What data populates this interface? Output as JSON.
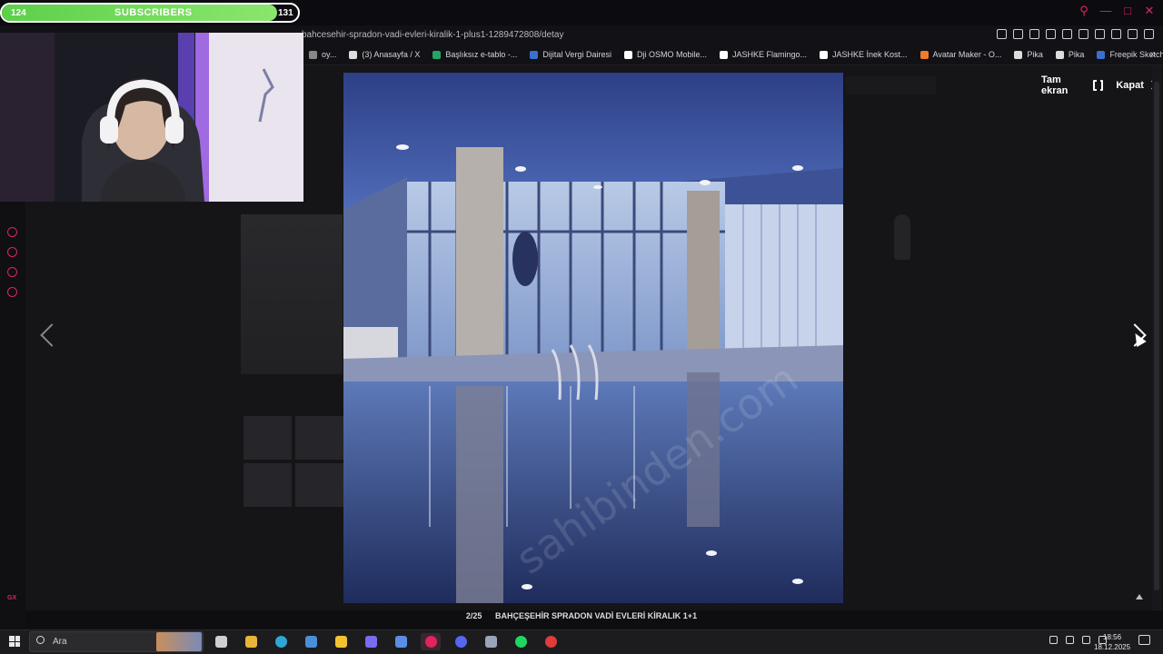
{
  "browser": {
    "url": "bahcesehir-spradon-vadi-evleri-kiralik-1-plus1-1289472808/detay",
    "bookmarks": [
      {
        "label": "oy...",
        "color": "#888888"
      },
      {
        "label": "(3) Anasayfa / X",
        "color": "#dddddd"
      },
      {
        "label": "Başlıksız e-tablo -...",
        "color": "#23a566"
      },
      {
        "label": "Dijital Vergi Dairesi",
        "color": "#3b6fd1"
      },
      {
        "label": "Dji OSMO Mobile...",
        "color": "#ffffff"
      },
      {
        "label": "JASHKE Flamingo...",
        "color": "#ffffff"
      },
      {
        "label": "JASHKE İnek Kost...",
        "color": "#ffffff"
      },
      {
        "label": "Avatar Maker - O...",
        "color": "#f07b2a"
      },
      {
        "label": "Pika",
        "color": "#dddddd"
      },
      {
        "label": "Pika",
        "color": "#dddddd"
      },
      {
        "label": "Freepik Sketch - F...",
        "color": "#3b6fd1"
      }
    ],
    "more": "»"
  },
  "stream": {
    "subscribers_start": "124",
    "subscribers_label": "SUBSCRIBERS",
    "subscribers_goal": "131",
    "subscribers_progress_pct": 0.93
  },
  "lightbox": {
    "fullscreen_label": "Tam ekran",
    "close_label": "Kapat",
    "counter": "2/25",
    "caption": "BAHÇEŞEHİR SPRADON VADİ EVLERİ KİRALIK 1+1",
    "watermark": "sahibinden.com"
  },
  "taskbar": {
    "search_placeholder": "Ara",
    "time": "18:56",
    "date": "18.12.2025",
    "apps": [
      {
        "name": "task-view",
        "color": "#cfcfcf"
      },
      {
        "name": "app-yellow",
        "color": "#e8b43a"
      },
      {
        "name": "edge",
        "color": "#2ea7d6"
      },
      {
        "name": "store",
        "color": "#4a8ed9"
      },
      {
        "name": "explorer",
        "color": "#f2c230"
      },
      {
        "name": "app-multi",
        "color": "#7a6cf0"
      },
      {
        "name": "app-blue",
        "color": "#5a8de6"
      },
      {
        "name": "opera-gx",
        "color": "#e0245e"
      },
      {
        "name": "discord",
        "color": "#5865f2"
      },
      {
        "name": "app-gray",
        "color": "#9aa3b8"
      },
      {
        "name": "spotify",
        "color": "#1ed760"
      },
      {
        "name": "app-record",
        "color": "#e23b3b"
      }
    ]
  },
  "colors": {
    "accent": "#e0245e",
    "subs_bar": "#6fdb55"
  }
}
